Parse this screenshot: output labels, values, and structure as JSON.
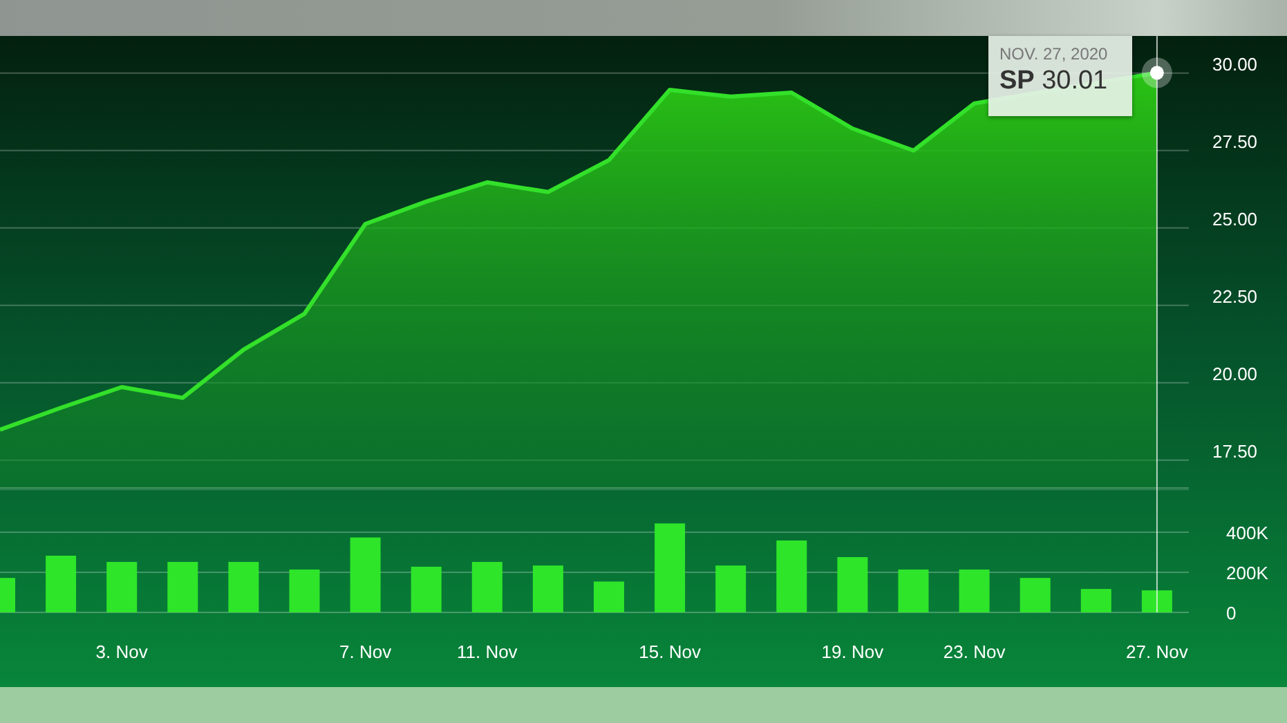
{
  "price_chart": {
    "tooltip": {
      "date": "NOV. 27, 2020",
      "value": "30.01"
    },
    "chart_data": {
      "type": "area",
      "grid": true,
      "ylim": [
        16.6,
        31.2
      ],
      "series": [
        {
          "name": "SP",
          "color": "#33e02a",
          "values": [
            18.48,
            19.19,
            19.86,
            19.51,
            21.07,
            22.23,
            25.13,
            25.85,
            26.47,
            26.16,
            27.19,
            29.46,
            29.24,
            29.37,
            28.21,
            27.5,
            29.02,
            null,
            null,
            30.01
          ]
        }
      ],
      "yticks": [
        {
          "value": 17.5,
          "label": "17.50"
        },
        {
          "value": 20,
          "label": "20.00"
        },
        {
          "value": 22.5,
          "label": "22.50"
        },
        {
          "value": 25,
          "label": "25.00"
        },
        {
          "value": 27.5,
          "label": "27.50"
        },
        {
          "value": 30,
          "label": "30.00"
        }
      ]
    }
  },
  "volume_chart": {
    "chart_data": {
      "type": "bar",
      "grid": true,
      "ylim": [
        0,
        614000
      ],
      "categories": [
        null,
        null,
        "3. Nov",
        null,
        null,
        null,
        "7. Nov",
        null,
        "11. Nov",
        null,
        null,
        "15. Nov",
        null,
        null,
        "19. Nov",
        null,
        "23. Nov",
        null,
        null,
        "27. Nov"
      ],
      "series": [
        {
          "color": "#2ee52a",
          "values": [
            172000,
            283000,
            252000,
            252000,
            252000,
            214000,
            374000,
            228000,
            252000,
            234000,
            154000,
            444000,
            234000,
            359000,
            276000,
            214000,
            214000,
            172000,
            117000,
            110000
          ]
        }
      ],
      "yticks": [
        {
          "value": 0,
          "label": "0"
        },
        {
          "value": 200000,
          "label": "200K"
        },
        {
          "value": 400000,
          "label": "400K"
        }
      ]
    }
  }
}
